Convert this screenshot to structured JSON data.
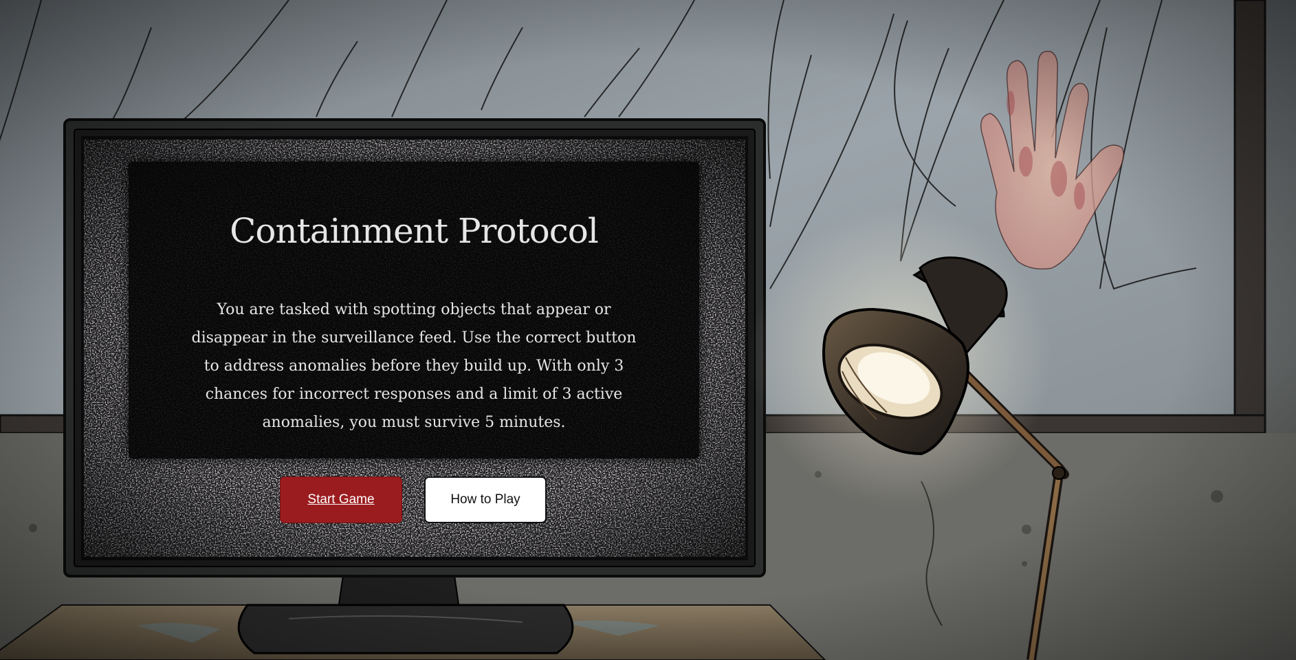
{
  "game": {
    "title": "Containment Protocol",
    "description": "You are tasked with spotting objects that appear or disappear in the surveillance feed. Use the correct button to address anomalies before they build up. With only 3 chances for incorrect responses and a limit of 3 active anomalies, you must survive 5 minutes.",
    "start_label": "Start Game",
    "howto_label": "How to Play"
  },
  "colors": {
    "start_button": "#9b1c1f",
    "howto_button": "#ffffff",
    "text": "#e6e6e6"
  },
  "scene": {
    "background_objects": [
      "rainy-window",
      "bloody-hand-print",
      "desk-lamp",
      "crt-monitor",
      "wooden-desk",
      "concrete-wall"
    ]
  }
}
